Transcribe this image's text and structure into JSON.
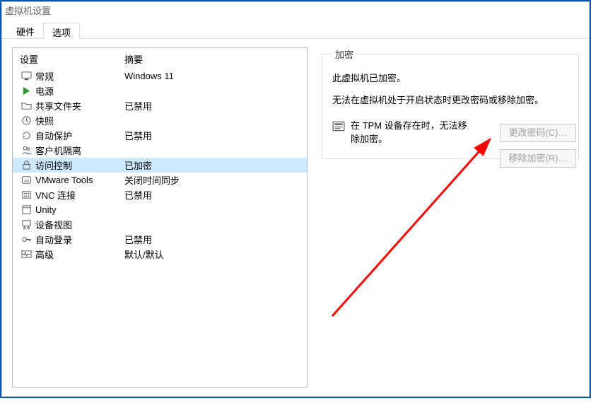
{
  "window": {
    "title": "虚拟机设置"
  },
  "tabs": {
    "hardware": "硬件",
    "options": "选项"
  },
  "list": {
    "header_setting": "设置",
    "header_summary": "摘要",
    "items": [
      {
        "icon": "monitor-icon",
        "label": "常规",
        "summary": "Windows 11"
      },
      {
        "icon": "play-icon",
        "label": "电源",
        "summary": ""
      },
      {
        "icon": "folder-icon",
        "label": "共享文件夹",
        "summary": "已禁用"
      },
      {
        "icon": "clock-icon",
        "label": "快照",
        "summary": ""
      },
      {
        "icon": "refresh-icon",
        "label": "自动保护",
        "summary": "已禁用"
      },
      {
        "icon": "people-icon",
        "label": "客户机隔离",
        "summary": ""
      },
      {
        "icon": "lock-icon",
        "label": "访问控制",
        "summary": "已加密"
      },
      {
        "icon": "boxvm-icon",
        "label": "VMware Tools",
        "summary": "关闭时间同步"
      },
      {
        "icon": "keypad-icon",
        "label": "VNC 连接",
        "summary": "已禁用"
      },
      {
        "icon": "window-icon",
        "label": "Unity",
        "summary": ""
      },
      {
        "icon": "diagram-icon",
        "label": "设备视图",
        "summary": ""
      },
      {
        "icon": "key-icon",
        "label": "自动登录",
        "summary": "已禁用"
      },
      {
        "icon": "pulse-icon",
        "label": "高级",
        "summary": "默认/默认"
      }
    ],
    "selected_index": 6
  },
  "panel": {
    "legend": "加密",
    "line1": "此虚拟机已加密。",
    "line2": "无法在虚拟机处于开启状态时更改密码或移除加密。",
    "note": "在 TPM 设备存在时，无法移除加密。",
    "btn_change": "更改密码(C)…",
    "btn_remove": "移除加密(R)…"
  }
}
